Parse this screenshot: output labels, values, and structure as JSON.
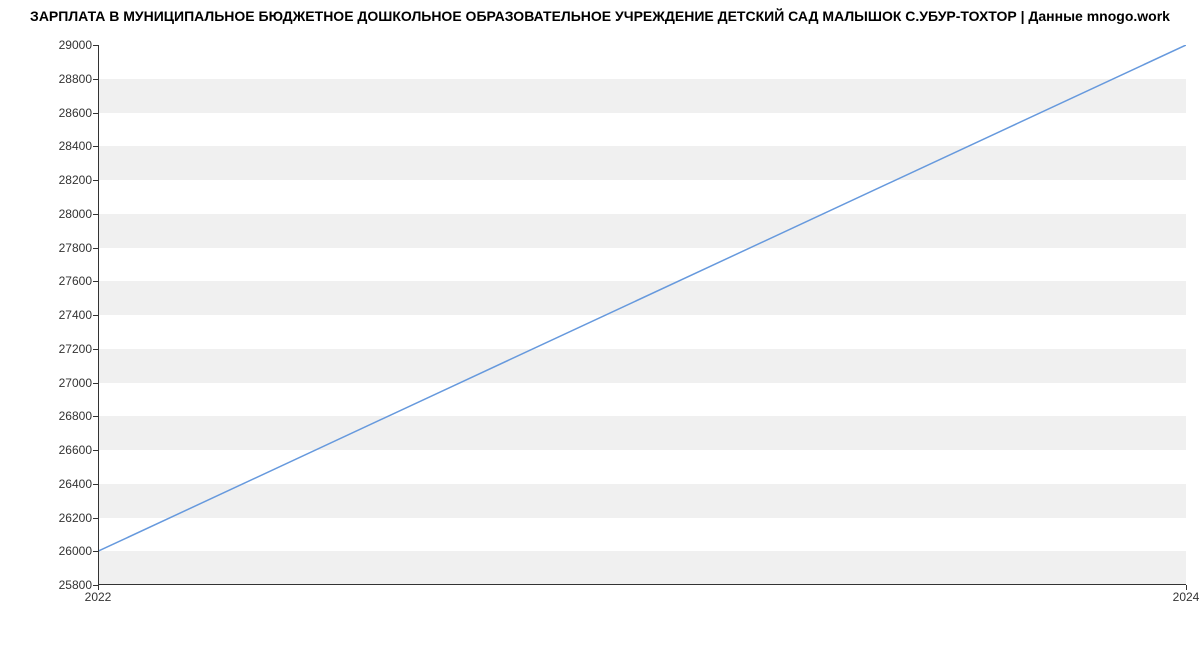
{
  "chart_data": {
    "type": "line",
    "title": "ЗАРПЛАТА В МУНИЦИПАЛЬНОЕ БЮДЖЕТНОЕ ДОШКОЛЬНОЕ ОБРАЗОВАТЕЛЬНОЕ УЧРЕЖДЕНИЕ ДЕТСКИЙ САД МАЛЫШОК С.УБУР-ТОХТОР | Данные mnogo.work",
    "x": [
      2022,
      2024
    ],
    "values": [
      26000,
      29000
    ],
    "xlabel": "",
    "ylabel": "",
    "x_ticks": [
      2022,
      2024
    ],
    "y_ticks": [
      25800,
      26000,
      26200,
      26400,
      26600,
      26800,
      27000,
      27200,
      27400,
      27600,
      27800,
      28000,
      28200,
      28400,
      28600,
      28800,
      29000
    ],
    "ylim": [
      25800,
      29000
    ],
    "xlim": [
      2022,
      2024
    ],
    "line_color": "#6699dd"
  }
}
